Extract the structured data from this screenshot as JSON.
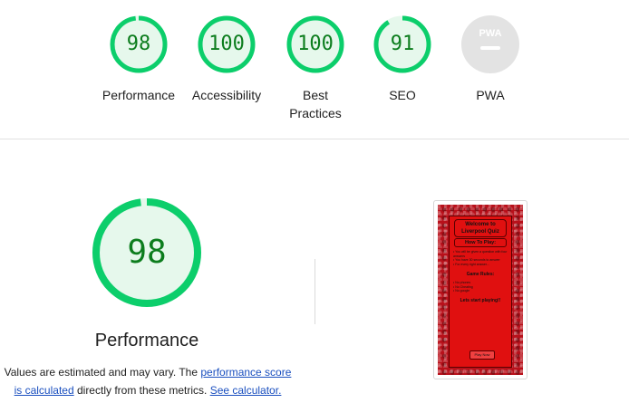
{
  "categories": [
    {
      "score": "98",
      "value": 98,
      "label": "Performance",
      "color": "#0cce6b"
    },
    {
      "score": "100",
      "value": 100,
      "label": "Accessibility",
      "color": "#0cce6b"
    },
    {
      "score": "100",
      "value": 100,
      "label": "Best Practices",
      "color": "#0cce6b"
    },
    {
      "score": "91",
      "value": 91,
      "label": "SEO",
      "color": "#0cce6b"
    },
    {
      "score": "PWA",
      "value": 0,
      "label": "PWA",
      "color": "#cccccc"
    }
  ],
  "performance": {
    "score": "98",
    "value": 98,
    "title": "Performance",
    "note_prefix": "Values are estimated and may vary. The ",
    "note_link1": "performance score is calculated",
    "note_mid": " directly from these metrics. ",
    "note_link2": "See calculator."
  },
  "screenshot": {
    "title": "Welcome to Liverpool Quiz",
    "how_to": "How To Play:",
    "instructions": [
      "You will be given a question with four answers",
      "You have 30 seconds to answer",
      "For every right answer..."
    ],
    "rules_title": "Game Rules:",
    "rules": [
      "No phones",
      "No Cheating",
      "No google"
    ],
    "start_text": "Lets start playing!!",
    "button": "Play Now"
  },
  "colors": {
    "pass": "#0cce6b",
    "pass_fill": "#e6f8ec",
    "pass_text": "#0c7d1d",
    "link": "#1a4fbf"
  }
}
